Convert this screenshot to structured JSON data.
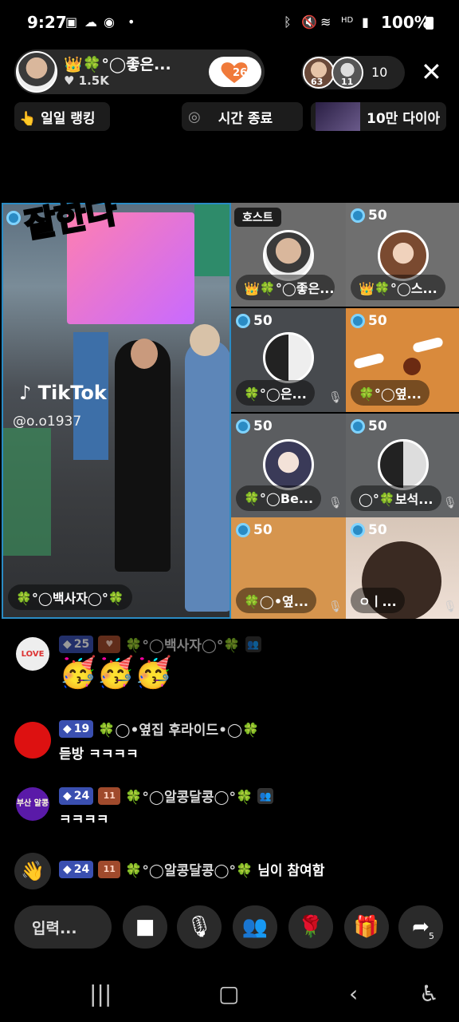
{
  "status_bar": {
    "time": "9:27",
    "battery": "100%"
  },
  "header": {
    "host_name": "👑🍀°◯좋은...",
    "likes": "♥ 1.5K",
    "gift_count": "26",
    "viewer_badges": [
      "63",
      "11"
    ],
    "viewer_count": "10",
    "close_label": "✕"
  },
  "ranking": {
    "daily_ranking": "👆 일일 랭킹",
    "timer_end": "시간 종료",
    "diamond_goal": "10만 다이아"
  },
  "main_video": {
    "caption": "잘한다",
    "tiktok": "TikTok",
    "handle": "@o.o1937",
    "name": "🍀°◯백사자◯°🍀"
  },
  "tiles": [
    {
      "badge": "",
      "name": "👑🍀°◯좋은...",
      "host_label": "호스트"
    },
    {
      "badge": "50",
      "name": "👑🍀°◯스..."
    },
    {
      "badge": "50",
      "name": "🍀°◯은..."
    },
    {
      "badge": "50",
      "name": "🍀°◯옆..."
    },
    {
      "badge": "50",
      "name": "🍀°◯Be..."
    },
    {
      "badge": "50",
      "name": "◯°🍀보석..."
    },
    {
      "badge": "50",
      "name": "🍀◯•옆..."
    },
    {
      "badge": "50",
      "name": "ㅇㅣ..."
    }
  ],
  "chat": [
    {
      "level": "25",
      "user": "🍀°◯백사자◯°🍀",
      "message": "🥳🥳🥳",
      "avatar_label": "LOVE"
    },
    {
      "level": "19",
      "user": "🍀◯•옆집 후라이드•◯🍀",
      "message": "듣방 ㅋㅋㅋㅋ"
    },
    {
      "level": "24",
      "fan": "11",
      "user": "🍀°◯알콩달콩◯°🍀",
      "message": "ㅋㅋㅋㅋ",
      "avatar_label": "부산 알콩"
    },
    {
      "level": "24",
      "fan": "11",
      "user": "🍀°◯알콩달콩◯°🍀",
      "message": "님이 참여함"
    }
  ],
  "controls": {
    "input_placeholder": "입력...",
    "share_count": "5"
  },
  "colors": {
    "accent_blue": "#2a8bc4",
    "level_badge": "#3a4fb0",
    "fan_badge": "#a04a2c",
    "gift_orange": "#f07a3a"
  }
}
